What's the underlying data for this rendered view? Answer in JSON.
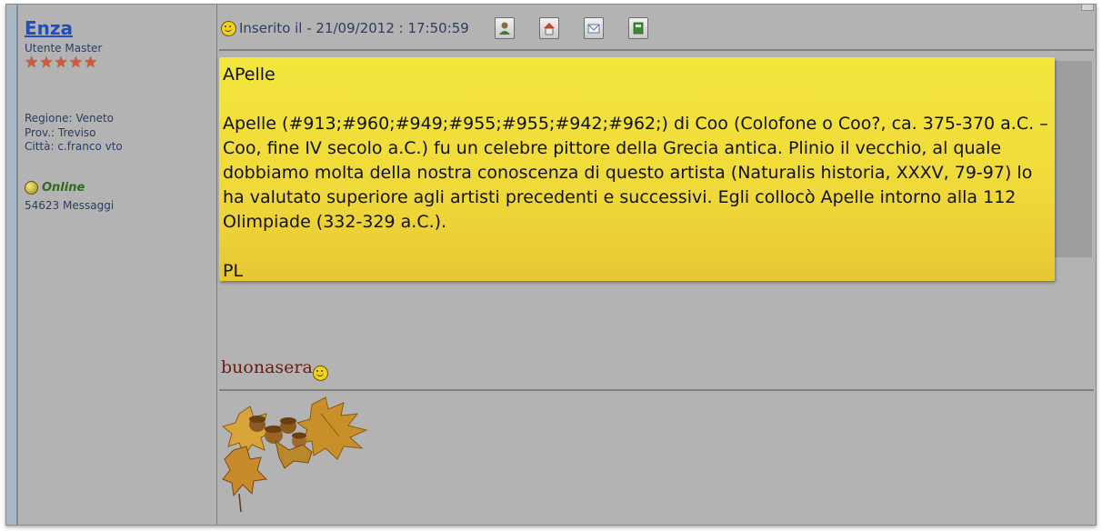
{
  "user": {
    "name": "Enza",
    "role": "Utente Master",
    "stars": 5,
    "region": "Regione: Veneto",
    "province": "Prov.: Treviso",
    "city": "Città: c.franco vto",
    "status": "Online",
    "message_count": "54623 Messaggi"
  },
  "post": {
    "posted_label": "Inserito il - 21/09/2012 : 17:50:59",
    "toolbar_icons": [
      "profile-icon",
      "home-icon",
      "email-icon",
      "edit-icon"
    ],
    "note_title": "APelle",
    "note_body": "Apelle (#913;#960;#949;#955;#955;#942;#962;) di Coo (Colofone o Coo?, ca. 375-370 a.C. – Coo, fine IV secolo a.C.) fu un celebre pittore della Grecia antica. Plinio il vecchio, al quale dobbiamo molta della nostra conoscenza di questo artista (Naturalis historia, XXXV, 79-97) lo ha valutato superiore agli artisti precedenti e successivi. Egli collocò Apelle intorno alla 112 Olimpiade (332-329 a.C.).",
    "note_signature": "PL",
    "greeting": "buonasera"
  },
  "colors": {
    "username": "#1f4fbf",
    "note": "#f0d93a",
    "greeting": "#6b1a10",
    "online": "#2f6b1f"
  }
}
